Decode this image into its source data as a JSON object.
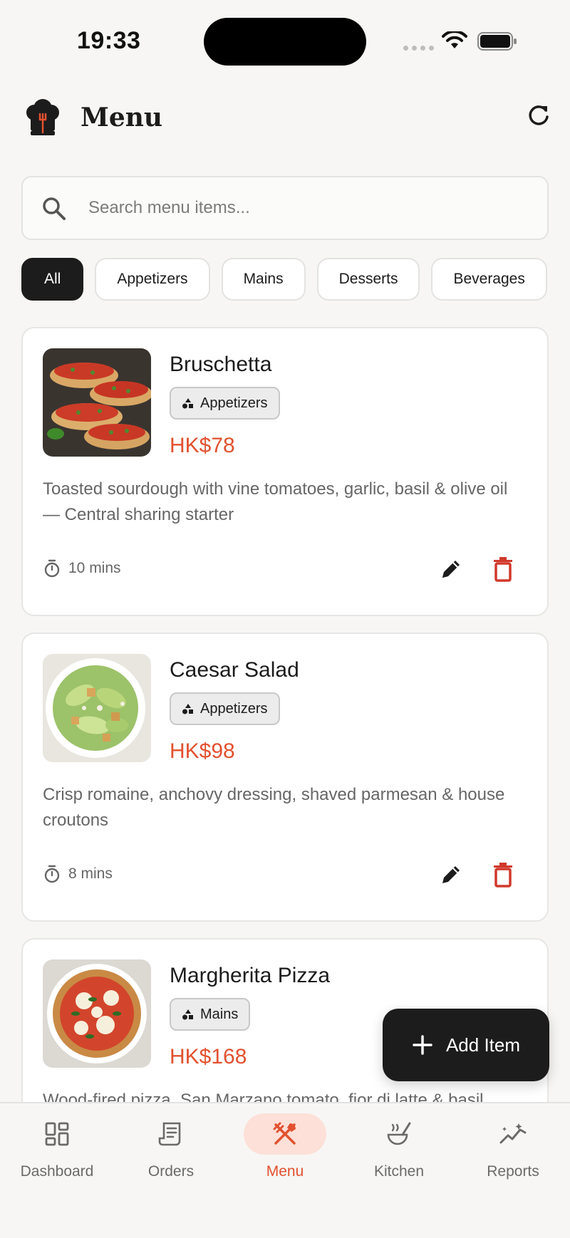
{
  "status_bar": {
    "time": "19:33"
  },
  "header": {
    "title": "Menu"
  },
  "search": {
    "placeholder": "Search menu items..."
  },
  "filters": [
    {
      "label": "All",
      "active": true
    },
    {
      "label": "Appetizers",
      "active": false
    },
    {
      "label": "Mains",
      "active": false
    },
    {
      "label": "Desserts",
      "active": false
    },
    {
      "label": "Beverages",
      "active": false
    }
  ],
  "items": [
    {
      "name": "Bruschetta",
      "category": "Appetizers",
      "price": "HK$78",
      "description": "Toasted sourdough with vine tomatoes, garlic, basil & olive oil — Central sharing starter",
      "prep_time": "10 mins"
    },
    {
      "name": "Caesar Salad",
      "category": "Appetizers",
      "price": "HK$98",
      "description": "Crisp romaine, anchovy dressing, shaved parmesan & house croutons",
      "prep_time": "8 mins"
    },
    {
      "name": "Margherita Pizza",
      "category": "Mains",
      "price": "HK$168",
      "description": "Wood-fired pizza, San Marzano tomato, fior di latte & basil",
      "prep_time": ""
    }
  ],
  "fab": {
    "label": "Add Item"
  },
  "nav": [
    {
      "label": "Dashboard",
      "icon": "dashboard-icon",
      "active": false
    },
    {
      "label": "Orders",
      "icon": "receipt-icon",
      "active": false
    },
    {
      "label": "Menu",
      "icon": "fork-knife-icon",
      "active": true
    },
    {
      "label": "Kitchen",
      "icon": "soup-icon",
      "active": false
    },
    {
      "label": "Reports",
      "icon": "trend-icon",
      "active": false
    }
  ],
  "colors": {
    "accent": "#e2512f",
    "dark": "#1c1c1c",
    "accent_soft": "#fde0d8",
    "background": "#f7f6f4"
  }
}
